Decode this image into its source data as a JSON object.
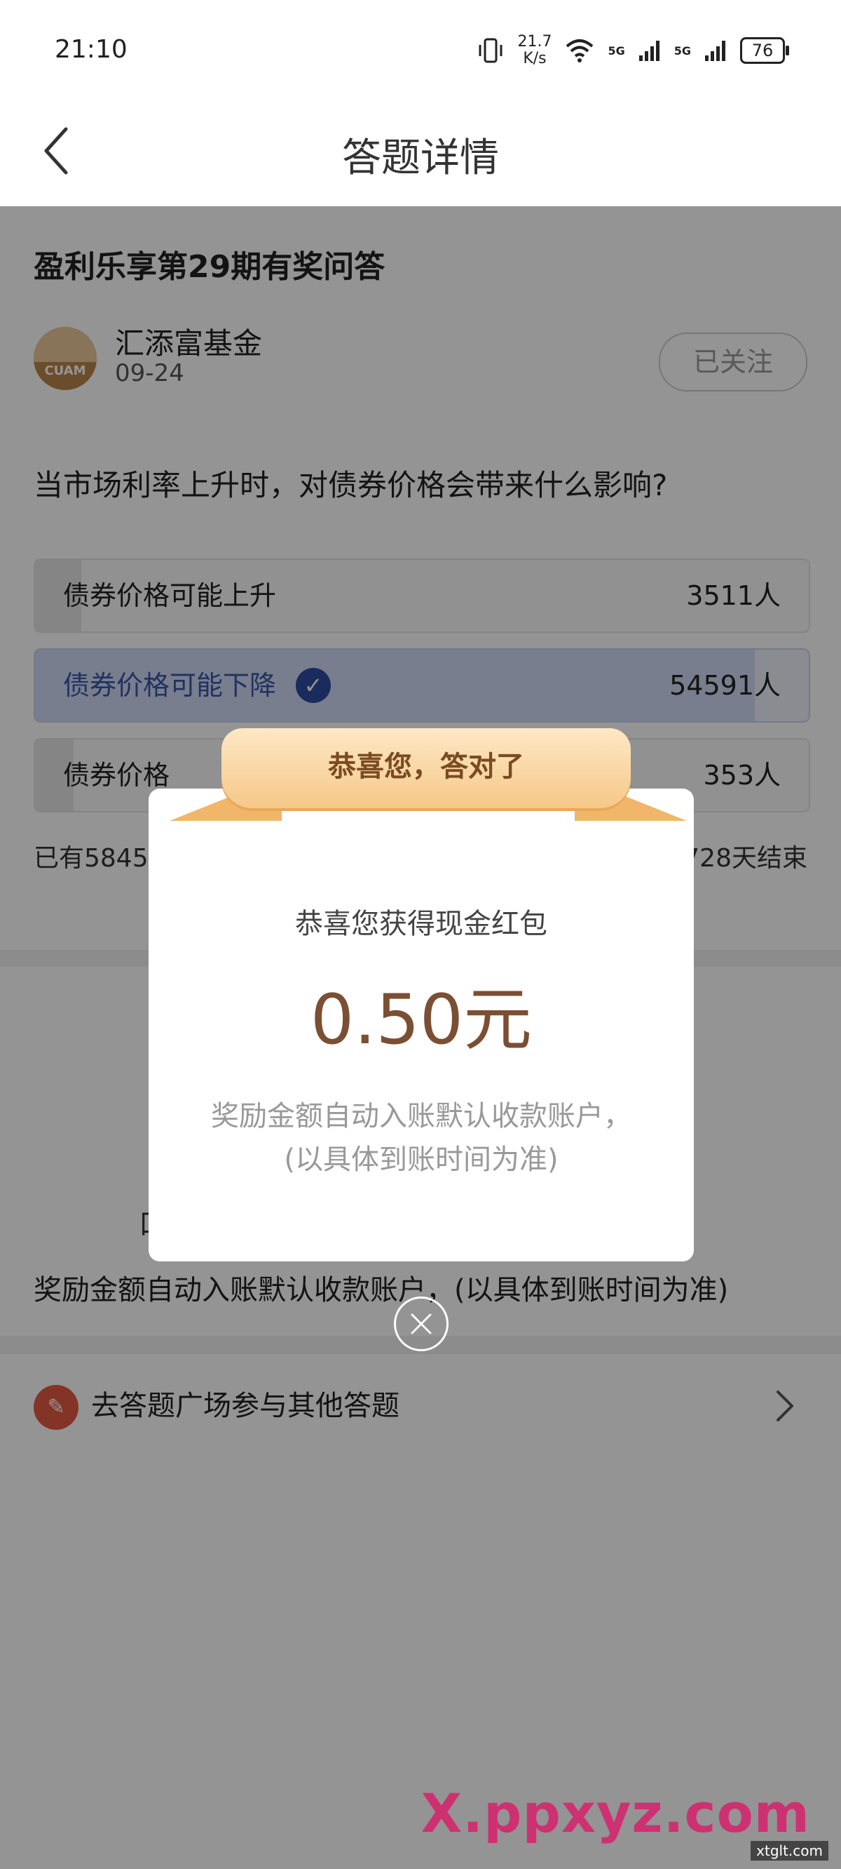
{
  "status_bar": {
    "time": "21:10",
    "speed_value": "21.7",
    "speed_unit": "K/s",
    "net1": "5G",
    "net2": "5G",
    "battery": "76"
  },
  "nav": {
    "title": "答题详情",
    "back_icon": "chevron-left-icon"
  },
  "quiz": {
    "title": "盈利乐享第29期有奖问答",
    "fund_name": "汇添富基金",
    "fund_date": "09-24",
    "avatar_text": "CUAM",
    "follow_label": "已关注",
    "question": "当市场利率上升时，对债券价格会带来什么影响?",
    "options": [
      {
        "label": "债券价格可能上升",
        "count": "3511人",
        "share": 0.06,
        "correct": false
      },
      {
        "label": "债券价格可能下降",
        "count": "54591人",
        "share": 0.93,
        "correct": true
      },
      {
        "label": "债券价格",
        "count": "353人",
        "share": 0.01,
        "correct": false
      }
    ],
    "stats_left": "已有5845",
    "stats_right": "728天结束"
  },
  "page": {
    "partial_char": "口",
    "reward_note": "奖励金额自动入账默认收款账户，(以具体到账时间为准)",
    "square_label": "去答题广场参与其他答题",
    "square_icon": "edit-icon"
  },
  "dialog": {
    "banner": "恭喜您，答对了",
    "subtitle": "恭喜您获得现金红包",
    "amount": "0.50元",
    "note1": "奖励金额自动入账默认收款账户，",
    "note2": "(以具体到账时间为准)",
    "close_icon": "close-icon"
  },
  "watermark": {
    "text": "X.ppxyz.com",
    "site": "xtglt.com"
  },
  "colors": {
    "accent": "#2d4aa0",
    "amount": "#7b4f33",
    "ribbon": "#f6c888"
  }
}
